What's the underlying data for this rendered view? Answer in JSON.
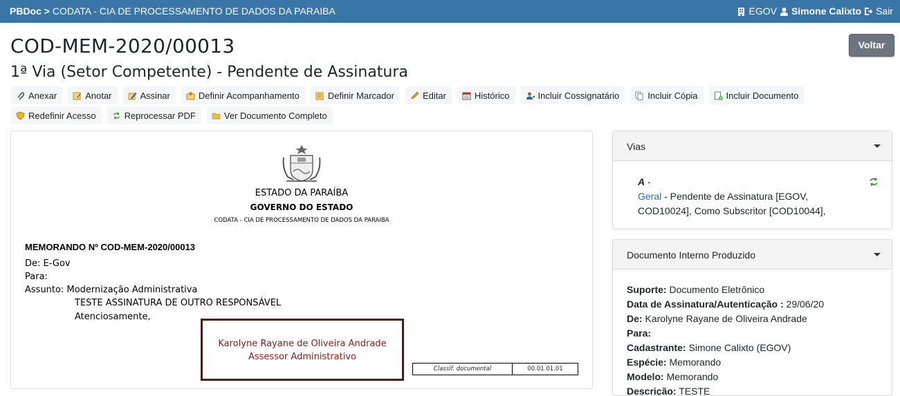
{
  "navbar": {
    "brand": "PBDoc",
    "separator": ">",
    "org": "CODATA - CIA DE PROCESSAMENTO DE DADOS DA PARAIBA",
    "unit": "EGOV",
    "user": "Simone Calixto",
    "logout": "Sair"
  },
  "page": {
    "title": "COD-MEM-2020/00013",
    "subtitle": "1ª Via (Setor Competente) - Pendente de Assinatura",
    "back_label": "Voltar"
  },
  "toolbar_row1": [
    {
      "label": "Anexar",
      "icon": "paperclip-icon"
    },
    {
      "label": "Anotar",
      "icon": "note-icon"
    },
    {
      "label": "Assinar",
      "icon": "sign-icon"
    },
    {
      "label": "Definir Acompanhamento",
      "icon": "follow-icon"
    },
    {
      "label": "Definir Marcador",
      "icon": "tag-icon"
    },
    {
      "label": "Editar",
      "icon": "pencil-icon"
    },
    {
      "label": "Histórico",
      "icon": "calendar-icon"
    },
    {
      "label": "Incluir Cossignatário",
      "icon": "user-add-icon"
    },
    {
      "label": "Incluir Cópia",
      "icon": "copy-icon"
    },
    {
      "label": "Incluir Documento",
      "icon": "document-add-icon"
    }
  ],
  "toolbar_row2": [
    {
      "label": "Redefinir Acesso",
      "icon": "shield-icon"
    },
    {
      "label": "Reprocessar PDF",
      "icon": "refresh-icon"
    },
    {
      "label": "Ver Documento Completo",
      "icon": "folder-icon"
    }
  ],
  "document": {
    "state": "ESTADO DA PARAÍBA",
    "government": "GOVERNO DO ESTADO",
    "company": "CODATA - CIA DE PROCESSAMENTO DE DADOS DA PARAIBA",
    "memo_title": "MEMORANDO Nº COD-MEM-2020/00013",
    "from": "De: E-Gov",
    "to": "Para:",
    "subject": "Assunto: Modernização Administrativa",
    "body": "TESTE ASSINATURA DE OUTRO RESPONSÁVEL",
    "closing": "Atenciosamente,",
    "signer_name": "Karolyne Rayane de Oliveira Andrade",
    "signer_role": "Assessor Administrativo",
    "classif_label": "Classif. documental",
    "classif_value": "00.01.01.01"
  },
  "vias": {
    "header": "Vias",
    "letter": "A",
    "dash": "-",
    "link": "Geral",
    "line1": "- Pendente de Assinatura [EGOV,",
    "line2": "COD10024], Como Subscritor [COD10044],"
  },
  "doc_interno": {
    "header": "Documento Interno Produzido",
    "props": [
      {
        "label": "Suporte:",
        "value": "Documento Eletrônico"
      },
      {
        "label": "Data de Assinatura/Autenticação :",
        "value": "29/06/20"
      },
      {
        "label": "De:",
        "value": "Karolyne Rayane de Oliveira Andrade"
      },
      {
        "label": "Para:",
        "value": ""
      },
      {
        "label": "Cadastrante:",
        "value": "Simone Calixto (EGOV)"
      },
      {
        "label": "Espécie:",
        "value": "Memorando"
      },
      {
        "label": "Modelo:",
        "value": "Memorando"
      },
      {
        "label": "Descrição:",
        "value": "TESTE"
      }
    ]
  }
}
